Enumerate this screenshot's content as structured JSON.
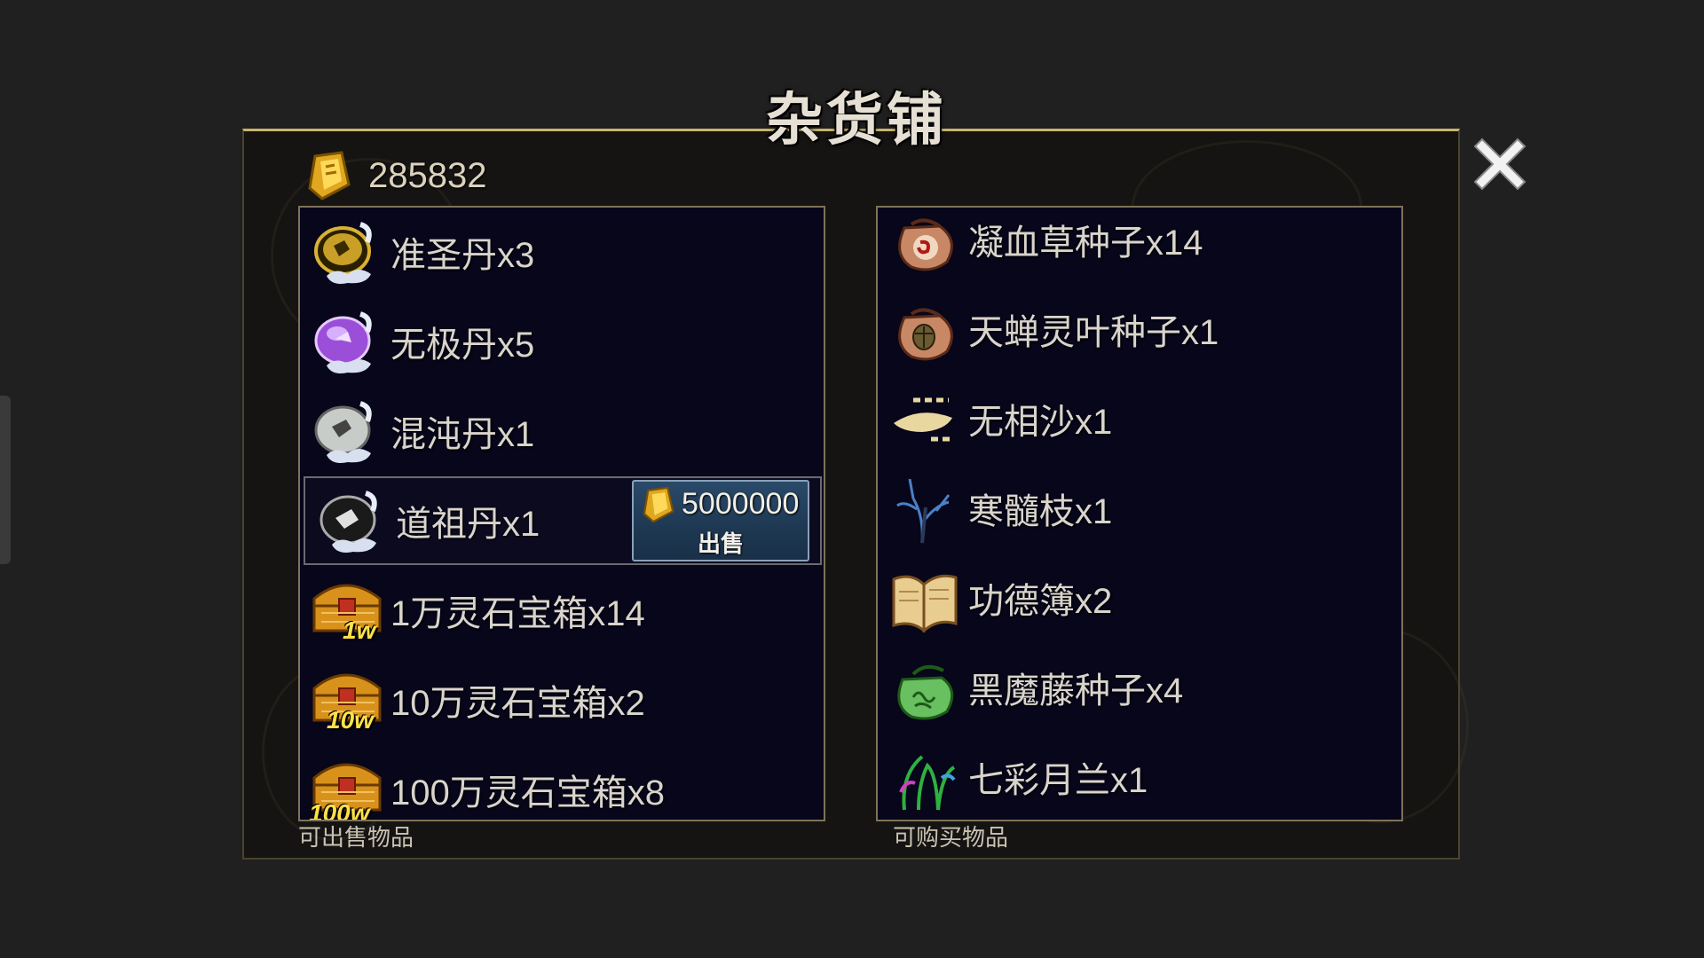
{
  "title": "杂货铺",
  "currency": {
    "icon": "gold-ingot-icon",
    "value": "285832"
  },
  "left_panel": {
    "caption": "可出售物品",
    "items": [
      {
        "name": "准圣丹x3",
        "icon": "gold-pill-icon"
      },
      {
        "name": "无极丹x5",
        "icon": "purple-pill-icon"
      },
      {
        "name": "混沌丹x1",
        "icon": "gray-pill-icon"
      },
      {
        "name": "道祖丹x1",
        "icon": "black-pill-icon",
        "selected": true
      },
      {
        "name": "1万灵石宝箱x14",
        "icon": "treasure-chest-icon",
        "badge": "1w"
      },
      {
        "name": "10万灵石宝箱x2",
        "icon": "treasure-chest-icon",
        "badge": "10w"
      },
      {
        "name": "100万灵石宝箱x8",
        "icon": "treasure-chest-icon",
        "badge": "100w"
      }
    ]
  },
  "sell_button": {
    "price": "5000000",
    "label": "出售",
    "icon": "gold-ingot-icon"
  },
  "right_panel": {
    "caption": "可购买物品",
    "items": [
      {
        "name": "凝血草种子x14",
        "icon": "seed-bag-icon"
      },
      {
        "name": "天蝉灵叶种子x1",
        "icon": "seed-bag-icon"
      },
      {
        "name": "无相沙x1",
        "icon": "sand-icon"
      },
      {
        "name": "寒髓枝x1",
        "icon": "branch-icon"
      },
      {
        "name": "功德簿x2",
        "icon": "book-icon"
      },
      {
        "name": "黑魔藤种子x4",
        "icon": "green-seed-bag-icon"
      },
      {
        "name": "七彩月兰x1",
        "icon": "orchid-icon"
      }
    ]
  },
  "colors": {
    "background": "#202020",
    "panel": "#07061a",
    "frame_border": "#c8b46e",
    "sell_button": "#1e3852"
  }
}
